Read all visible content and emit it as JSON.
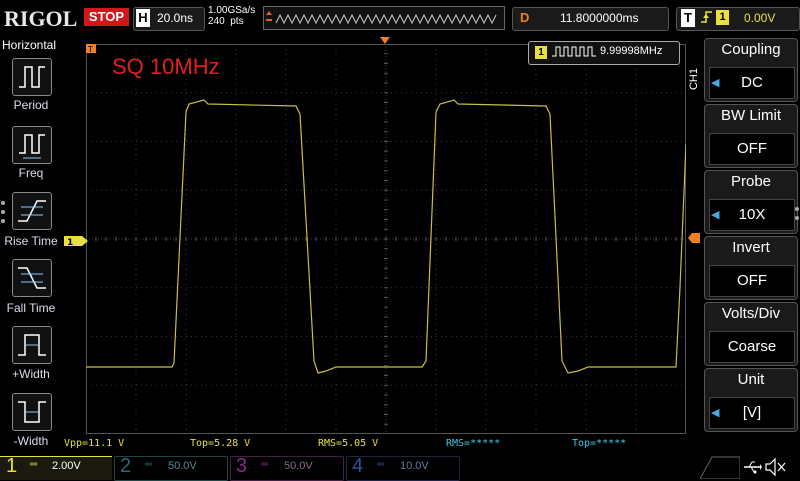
{
  "topbar": {
    "logo": "RIGOL",
    "run_state": "STOP",
    "horizontal_key": "H",
    "timebase": "20.0ns",
    "sample_rate": "1.00GSa/s",
    "memory_depth": "240  pts",
    "delay_key": "D",
    "delay_value": "11.8000000ms",
    "trigger_key": "T",
    "trigger_channel": "1",
    "trigger_level": "0.00V"
  },
  "left_panel": {
    "title": "Horizontal",
    "items": [
      {
        "label": "Period",
        "icon": "period-icon"
      },
      {
        "label": "Freq",
        "icon": "freq-icon"
      },
      {
        "label": "Rise Time",
        "icon": "rise-time-icon"
      },
      {
        "label": "Fall Time",
        "icon": "fall-time-icon"
      },
      {
        "label": "+Width",
        "icon": "positive-width-icon"
      },
      {
        "label": "-Width",
        "icon": "negative-width-icon"
      }
    ]
  },
  "screen": {
    "annotation": "SQ 10MHz",
    "frequency_channel": "1",
    "frequency_readout": "9.99998MHz",
    "trigger_marker": "T"
  },
  "right_panel": {
    "channel_label": "CH1",
    "items": [
      {
        "title": "Coupling",
        "value": "DC"
      },
      {
        "title": "BW Limit",
        "value": "OFF"
      },
      {
        "title": "Probe",
        "value": "10X"
      },
      {
        "title": "Invert",
        "value": "OFF"
      },
      {
        "title": "Volts/Div",
        "value": "Coarse"
      },
      {
        "title": "Unit",
        "value": "[V]"
      }
    ]
  },
  "measurements": [
    {
      "text": "Vpp=11.1 V",
      "color": "#e8e040"
    },
    {
      "text": "Top=5.28 V",
      "color": "#e8e040"
    },
    {
      "text": "RMS=5.05 V",
      "color": "#e8e040"
    },
    {
      "text": "RMS=*****",
      "color": "#40c8e8"
    },
    {
      "text": "Top=*****",
      "color": "#40c8e8"
    }
  ],
  "channels": [
    {
      "num": "1",
      "scale": "2.00V",
      "color": "#e8e040",
      "active": true
    },
    {
      "num": "2",
      "scale": "50.0V",
      "color": "#40c8e8",
      "active": false
    },
    {
      "num": "3",
      "scale": "50.0V",
      "color": "#d040d0",
      "active": false
    },
    {
      "num": "4",
      "scale": "10.0V",
      "color": "#3060e0",
      "active": false
    }
  ],
  "colors": {
    "trace": "#c8c040",
    "grid": "#3a3a3a",
    "accent": "#f08020",
    "stop": "#d01818"
  }
}
